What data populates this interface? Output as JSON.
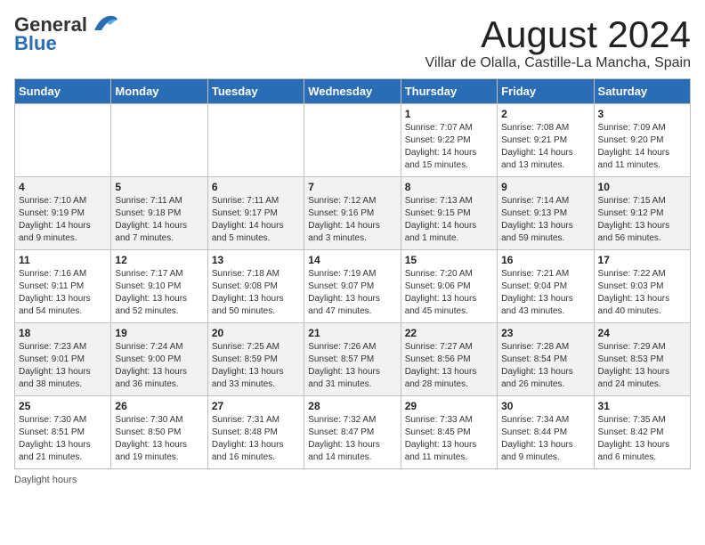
{
  "logo": {
    "general": "General",
    "blue": "Blue"
  },
  "title": {
    "month_year": "August 2024",
    "location": "Villar de Olalla, Castille-La Mancha, Spain"
  },
  "weekdays": [
    "Sunday",
    "Monday",
    "Tuesday",
    "Wednesday",
    "Thursday",
    "Friday",
    "Saturday"
  ],
  "weeks": [
    [
      {
        "day": "",
        "info": ""
      },
      {
        "day": "",
        "info": ""
      },
      {
        "day": "",
        "info": ""
      },
      {
        "day": "",
        "info": ""
      },
      {
        "day": "1",
        "info": "Sunrise: 7:07 AM\nSunset: 9:22 PM\nDaylight: 14 hours and 15 minutes."
      },
      {
        "day": "2",
        "info": "Sunrise: 7:08 AM\nSunset: 9:21 PM\nDaylight: 14 hours and 13 minutes."
      },
      {
        "day": "3",
        "info": "Sunrise: 7:09 AM\nSunset: 9:20 PM\nDaylight: 14 hours and 11 minutes."
      }
    ],
    [
      {
        "day": "4",
        "info": "Sunrise: 7:10 AM\nSunset: 9:19 PM\nDaylight: 14 hours and 9 minutes."
      },
      {
        "day": "5",
        "info": "Sunrise: 7:11 AM\nSunset: 9:18 PM\nDaylight: 14 hours and 7 minutes."
      },
      {
        "day": "6",
        "info": "Sunrise: 7:11 AM\nSunset: 9:17 PM\nDaylight: 14 hours and 5 minutes."
      },
      {
        "day": "7",
        "info": "Sunrise: 7:12 AM\nSunset: 9:16 PM\nDaylight: 14 hours and 3 minutes."
      },
      {
        "day": "8",
        "info": "Sunrise: 7:13 AM\nSunset: 9:15 PM\nDaylight: 14 hours and 1 minute."
      },
      {
        "day": "9",
        "info": "Sunrise: 7:14 AM\nSunset: 9:13 PM\nDaylight: 13 hours and 59 minutes."
      },
      {
        "day": "10",
        "info": "Sunrise: 7:15 AM\nSunset: 9:12 PM\nDaylight: 13 hours and 56 minutes."
      }
    ],
    [
      {
        "day": "11",
        "info": "Sunrise: 7:16 AM\nSunset: 9:11 PM\nDaylight: 13 hours and 54 minutes."
      },
      {
        "day": "12",
        "info": "Sunrise: 7:17 AM\nSunset: 9:10 PM\nDaylight: 13 hours and 52 minutes."
      },
      {
        "day": "13",
        "info": "Sunrise: 7:18 AM\nSunset: 9:08 PM\nDaylight: 13 hours and 50 minutes."
      },
      {
        "day": "14",
        "info": "Sunrise: 7:19 AM\nSunset: 9:07 PM\nDaylight: 13 hours and 47 minutes."
      },
      {
        "day": "15",
        "info": "Sunrise: 7:20 AM\nSunset: 9:06 PM\nDaylight: 13 hours and 45 minutes."
      },
      {
        "day": "16",
        "info": "Sunrise: 7:21 AM\nSunset: 9:04 PM\nDaylight: 13 hours and 43 minutes."
      },
      {
        "day": "17",
        "info": "Sunrise: 7:22 AM\nSunset: 9:03 PM\nDaylight: 13 hours and 40 minutes."
      }
    ],
    [
      {
        "day": "18",
        "info": "Sunrise: 7:23 AM\nSunset: 9:01 PM\nDaylight: 13 hours and 38 minutes."
      },
      {
        "day": "19",
        "info": "Sunrise: 7:24 AM\nSunset: 9:00 PM\nDaylight: 13 hours and 36 minutes."
      },
      {
        "day": "20",
        "info": "Sunrise: 7:25 AM\nSunset: 8:59 PM\nDaylight: 13 hours and 33 minutes."
      },
      {
        "day": "21",
        "info": "Sunrise: 7:26 AM\nSunset: 8:57 PM\nDaylight: 13 hours and 31 minutes."
      },
      {
        "day": "22",
        "info": "Sunrise: 7:27 AM\nSunset: 8:56 PM\nDaylight: 13 hours and 28 minutes."
      },
      {
        "day": "23",
        "info": "Sunrise: 7:28 AM\nSunset: 8:54 PM\nDaylight: 13 hours and 26 minutes."
      },
      {
        "day": "24",
        "info": "Sunrise: 7:29 AM\nSunset: 8:53 PM\nDaylight: 13 hours and 24 minutes."
      }
    ],
    [
      {
        "day": "25",
        "info": "Sunrise: 7:30 AM\nSunset: 8:51 PM\nDaylight: 13 hours and 21 minutes."
      },
      {
        "day": "26",
        "info": "Sunrise: 7:30 AM\nSunset: 8:50 PM\nDaylight: 13 hours and 19 minutes."
      },
      {
        "day": "27",
        "info": "Sunrise: 7:31 AM\nSunset: 8:48 PM\nDaylight: 13 hours and 16 minutes."
      },
      {
        "day": "28",
        "info": "Sunrise: 7:32 AM\nSunset: 8:47 PM\nDaylight: 13 hours and 14 minutes."
      },
      {
        "day": "29",
        "info": "Sunrise: 7:33 AM\nSunset: 8:45 PM\nDaylight: 13 hours and 11 minutes."
      },
      {
        "day": "30",
        "info": "Sunrise: 7:34 AM\nSunset: 8:44 PM\nDaylight: 13 hours and 9 minutes."
      },
      {
        "day": "31",
        "info": "Sunrise: 7:35 AM\nSunset: 8:42 PM\nDaylight: 13 hours and 6 minutes."
      }
    ]
  ],
  "footer": {
    "note": "Daylight hours"
  }
}
